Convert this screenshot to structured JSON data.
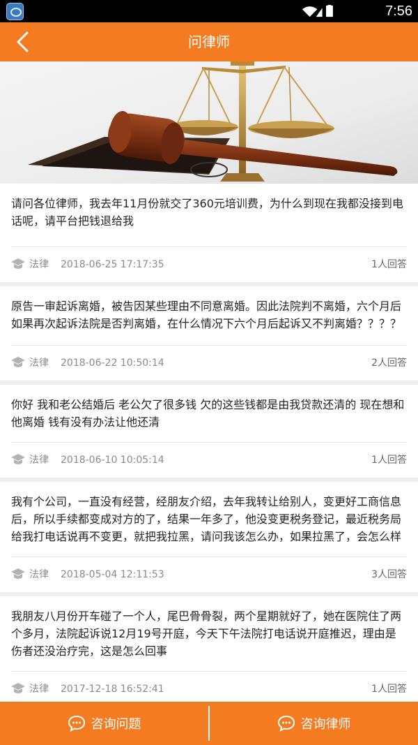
{
  "status_bar": {
    "time": "7:56"
  },
  "header": {
    "title": "问律师"
  },
  "questions": [
    {
      "text": "请问各位律师，我去年11月份就交了360元培训费，为什么到现在我都没接到电话呢，请平台把钱退给我",
      "category": "法律",
      "date": "2018-06-25 17:17:35",
      "answers": "1人回答"
    },
    {
      "text": "原告一审起诉离婚，被告因某些理由不同意离婚。因此法院判不离婚，六个月后如果再次起诉法院是否判离婚，在什么情况下六个月后起诉又不判离婚？？？？",
      "category": "法律",
      "date": "2018-06-22 10:50:14",
      "answers": "2人回答"
    },
    {
      "text": "你好  我和老公结婚后  老公欠了很多钱   欠的这些钱都是由我贷款还清的 现在想和他离婚     钱有没有办法让他还清",
      "category": "法律",
      "date": "2018-06-10 10:05:14",
      "answers": "1人回答"
    },
    {
      "text": "我有个公司，一直没有经营，经朋友介绍，去年我转让给别人，变更好工商信息后，所以手续都变成对方的了，结果一年多了，他没变更税务登记，最近税务局给我打电话说再不变更，就把我拉黑，请问我该怎么办，如果拉黑了，会怎么样",
      "category": "法律",
      "date": "2018-05-04 12:11:53",
      "answers": "3人回答"
    },
    {
      "text": "我朋友八月份开车碰了一个人，尾巴骨骨裂，两个星期就好了，她在医院住了两个多月，法院起诉说12月19号开庭，今天下午法院打电话说开庭推迟，理由是伤者还没治疗完，这是怎么回事",
      "category": "法律",
      "date": "2017-12-18 16:52:41",
      "answers": "1人回答"
    }
  ],
  "bottom_bar": {
    "consult_question": "咨询问题",
    "consult_lawyer": "咨询律师"
  },
  "colors": {
    "accent": "#f47b20",
    "background": "#efefef"
  }
}
